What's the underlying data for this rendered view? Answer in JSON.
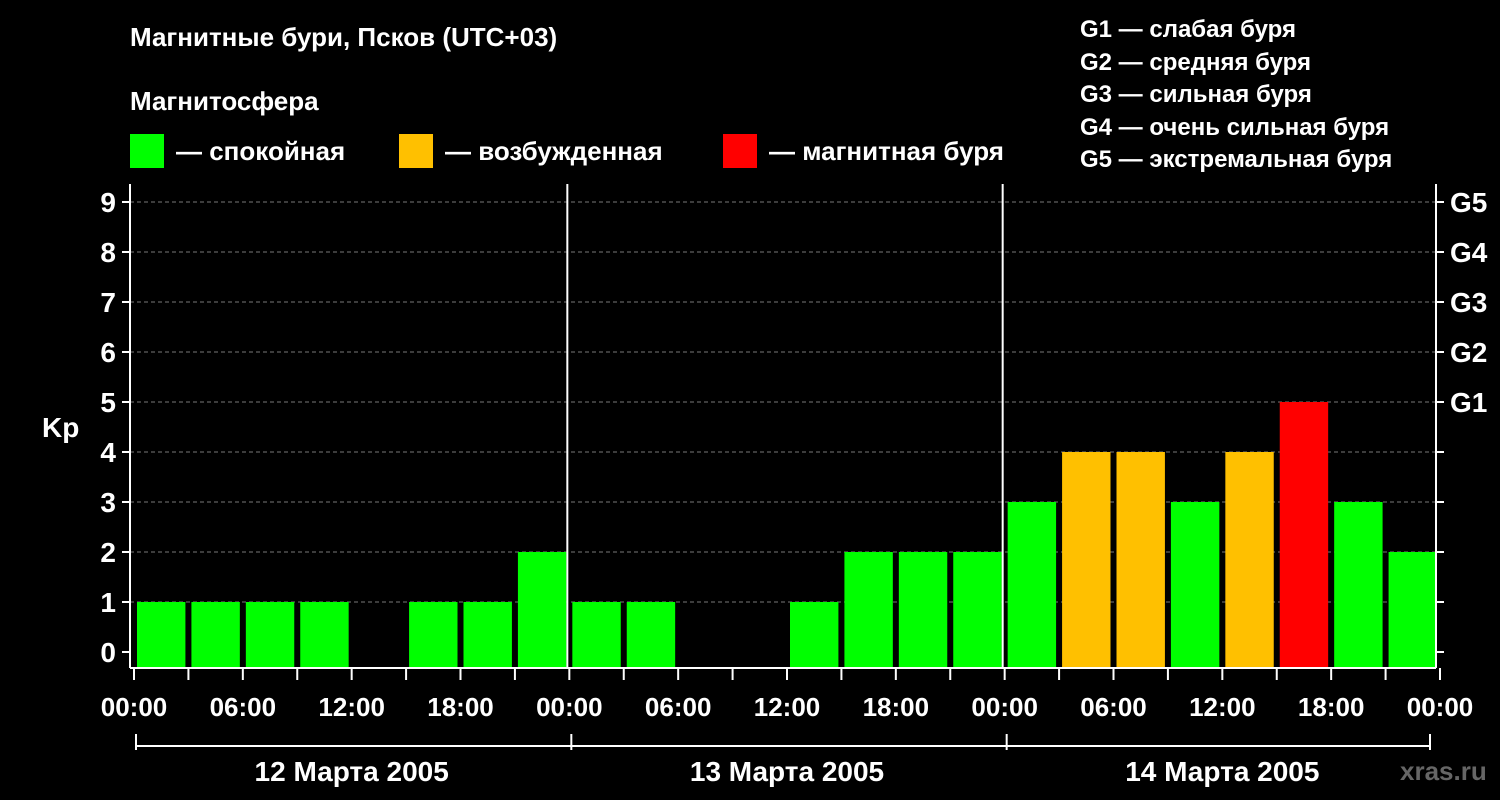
{
  "title": "Магнитные бури, Псков (UTC+03)",
  "subtitle": "Магнитосфера",
  "legend": [
    {
      "label": "— спокойная",
      "color": "#00ff00"
    },
    {
      "label": "— возбужденная",
      "color": "#ffc000"
    },
    {
      "label": "— магнитная буря",
      "color": "#ff0000"
    }
  ],
  "g_legend": [
    "G1 — слабая буря",
    "G2 — средняя буря",
    "G3 — сильная буря",
    "G4 — очень сильная буря",
    "G5 — экстремальная буря"
  ],
  "watermark": "xras.ru",
  "chart_data": {
    "type": "bar",
    "ylabel": "Kp",
    "ylim": [
      0,
      9
    ],
    "y_ticks": [
      "0",
      "1",
      "2",
      "3",
      "4",
      "5",
      "6",
      "7",
      "8",
      "9"
    ],
    "right_ticks": [
      {
        "kp": 5,
        "label": "G1"
      },
      {
        "kp": 6,
        "label": "G2"
      },
      {
        "kp": 7,
        "label": "G3"
      },
      {
        "kp": 8,
        "label": "G4"
      },
      {
        "kp": 9,
        "label": "G5"
      }
    ],
    "x_tick_labels": [
      "00:00",
      "06:00",
      "12:00",
      "18:00",
      "00:00",
      "06:00",
      "12:00",
      "18:00",
      "00:00",
      "06:00",
      "12:00",
      "18:00",
      "00:00"
    ],
    "days": [
      "12 Марта 2005",
      "13 Марта 2005",
      "14 Марта 2005"
    ],
    "interval_hours": 3,
    "values": [
      1,
      1,
      1,
      1,
      0,
      1,
      1,
      2,
      1,
      1,
      0,
      0,
      1,
      2,
      2,
      2,
      3,
      4,
      4,
      3,
      4,
      5,
      3,
      2
    ],
    "status": [
      "calm",
      "calm",
      "calm",
      "calm",
      "calm",
      "calm",
      "calm",
      "calm",
      "calm",
      "calm",
      "calm",
      "calm",
      "calm",
      "calm",
      "calm",
      "calm",
      "calm",
      "active",
      "active",
      "calm",
      "active",
      "storm",
      "calm",
      "calm"
    ],
    "status_colors": {
      "calm": "#00ff00",
      "active": "#ffc000",
      "storm": "#ff0000"
    },
    "grid": true
  }
}
